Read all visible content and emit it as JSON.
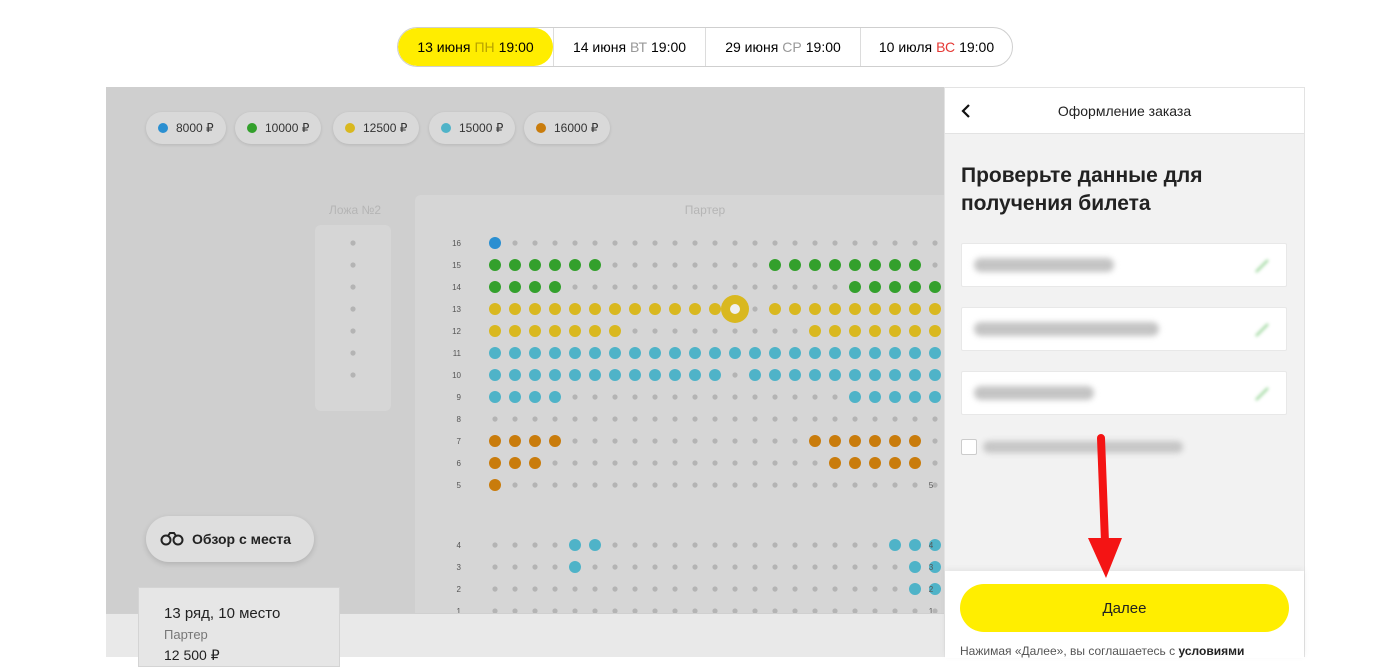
{
  "date_tabs": [
    {
      "date": "13 июня",
      "weekday": "ПН",
      "time": "19:00",
      "active": true,
      "weekend": false
    },
    {
      "date": "14 июня",
      "weekday": "ВТ",
      "time": "19:00",
      "active": false,
      "weekend": false
    },
    {
      "date": "29 июня",
      "weekday": "СР",
      "time": "19:00",
      "active": false,
      "weekend": false
    },
    {
      "date": "10 июля",
      "weekday": "ВС",
      "time": "19:00",
      "active": false,
      "weekend": true
    }
  ],
  "prices": [
    {
      "label": "8000 ₽",
      "color": "#2a8fd1"
    },
    {
      "label": "10000 ₽",
      "color": "#33a02c"
    },
    {
      "label": "12500 ₽",
      "color": "#d9b81f"
    },
    {
      "label": "15000 ₽",
      "color": "#4fb3c8"
    },
    {
      "label": "16000 ₽",
      "color": "#c97c0c"
    }
  ],
  "sections": {
    "box": "Ложа №2",
    "parter": "Партер"
  },
  "view_button": {
    "label": "Обзор с места",
    "icon": "binoculars-icon"
  },
  "selected_seat": {
    "title": "13 ряд, 10 место",
    "section": "Партер",
    "price": "12 500 ₽"
  },
  "panel": {
    "header": "Оформление заказа",
    "title": "Проверьте данные для получения билета",
    "fields": [
      "name-field",
      "email-field",
      "phone-field"
    ],
    "next_label": "Далее",
    "footer_text": "Нажимая «Далее», вы соглашаетесь с ",
    "footer_link": "условиями"
  },
  "seat_rows": [
    {
      "row": "16",
      "layout": "B..............................."
    },
    {
      "row": "15",
      "layout": "GGGGGG........GGGGGGGG"
    },
    {
      "row": "14",
      "layout": "GGGG..............GGGGGG"
    },
    {
      "row": "13",
      "layout": "YYYYYYYYYYYYS.YYYYYYYYY"
    },
    {
      "row": "12",
      "layout": "YYYYYYY.........YYYYYYY"
    },
    {
      "row": "11",
      "layout": "CCCCCCCCCCCCCCCCCCCCCCC"
    },
    {
      "row": "10",
      "layout": "CCCCCCCCCCCC.CCCCCCCCCCC"
    },
    {
      "row": "9",
      "layout": "CCCC..............CCCCCC"
    },
    {
      "row": "8",
      "layout": "........................"
    },
    {
      "row": "7",
      "layout": "OOOO............OOOOOO"
    },
    {
      "row": "6",
      "layout": "OOO..............OOOOO"
    },
    {
      "row": "5",
      "layout": "O......................."
    },
    {
      "row": "4",
      "layout": "....CC..............CCCCC"
    },
    {
      "row": "3",
      "layout": "....C................CCCC"
    },
    {
      "row": "2",
      "layout": ".....................CCC"
    },
    {
      "row": "1",
      "layout": "......................."
    }
  ]
}
